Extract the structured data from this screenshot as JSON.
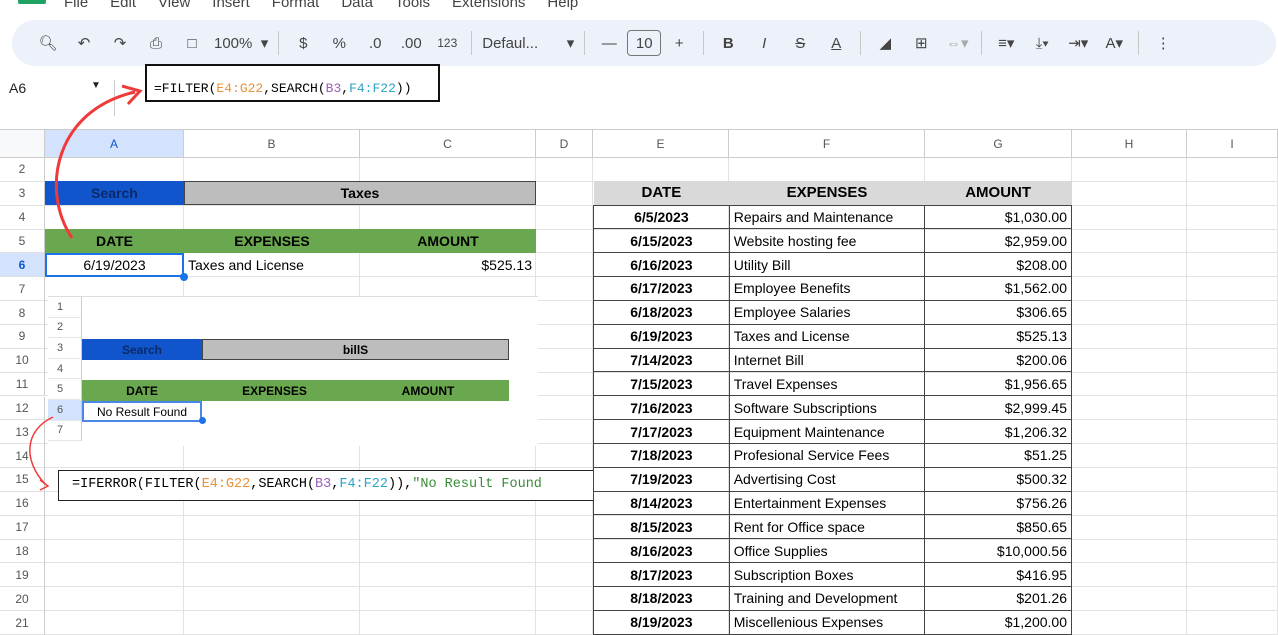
{
  "menu": [
    "File",
    "Edit",
    "View",
    "Insert",
    "Format",
    "Data",
    "Tools",
    "Extensions",
    "Help"
  ],
  "toolbar": {
    "zoom": "100%",
    "currency": "$",
    "percent": "%",
    "dec_less": ".0",
    "dec_more": ".00",
    "number_format": "123",
    "font": "Defaul...",
    "font_size": "10"
  },
  "name_box": "A6",
  "formula_bar": {
    "prefix": "=FILTER(",
    "r1": "E4:G22",
    "mid": ",SEARCH(",
    "r2": "B3",
    "comma": ",",
    "r3": "F4:F22",
    "suffix": "))"
  },
  "columns": [
    "A",
    "B",
    "C",
    "D",
    "E",
    "F",
    "G",
    "H",
    "I"
  ],
  "rows": [
    "2",
    "3",
    "4",
    "5",
    "6",
    "7",
    "8",
    "9",
    "10",
    "11",
    "12",
    "13",
    "14",
    "15",
    "16",
    "17",
    "18",
    "19",
    "20",
    "21"
  ],
  "search_block": {
    "label": "Search",
    "term": "Taxes",
    "headers": [
      "DATE",
      "EXPENSES",
      "AMOUNT"
    ],
    "result": {
      "date": "6/19/2023",
      "expense": "Taxes and License",
      "amount": "$525.13"
    }
  },
  "inset": {
    "rows": [
      "1",
      "2",
      "3",
      "4",
      "5",
      "6",
      "7"
    ],
    "label": "Search",
    "term": "billS",
    "headers": [
      "DATE",
      "EXPENSES",
      "AMOUNT"
    ],
    "result": "No Result Found",
    "formula": {
      "prefix": "=IFERROR(FILTER(",
      "r1": "E4:G22",
      "mid": ",SEARCH(",
      "r2": "B3",
      "comma": ",",
      "r3": "F4:F22",
      "close": ")),",
      "str": "\"No Result Found"
    }
  },
  "table": {
    "headers": [
      "DATE",
      "EXPENSES",
      "AMOUNT"
    ],
    "rows": [
      [
        "6/5/2023",
        "Repairs and Maintenance",
        "$1,030.00"
      ],
      [
        "6/15/2023",
        "Website hosting fee",
        "$2,959.00"
      ],
      [
        "6/16/2023",
        "Utility Bill",
        "$208.00"
      ],
      [
        "6/17/2023",
        "Employee Benefits",
        "$1,562.00"
      ],
      [
        "6/18/2023",
        "Employee Salaries",
        "$306.65"
      ],
      [
        "6/19/2023",
        "Taxes and License",
        "$525.13"
      ],
      [
        "7/14/2023",
        "Internet Bill",
        "$200.06"
      ],
      [
        "7/15/2023",
        "Travel Expenses",
        "$1,956.65"
      ],
      [
        "7/16/2023",
        "Software Subscriptions",
        "$2,999.45"
      ],
      [
        "7/17/2023",
        "Equipment Maintenance",
        "$1,206.32"
      ],
      [
        "7/18/2023",
        "Profesional Service Fees",
        "$51.25"
      ],
      [
        "7/19/2023",
        "Advertising Cost",
        "$500.32"
      ],
      [
        "8/14/2023",
        "Entertainment Expenses",
        "$756.26"
      ],
      [
        "8/15/2023",
        "Rent for Office space",
        "$850.65"
      ],
      [
        "8/16/2023",
        "Office Supplies",
        "$10,000.56"
      ],
      [
        "8/17/2023",
        "Subscription Boxes",
        "$416.95"
      ],
      [
        "8/18/2023",
        "Training and Development",
        "$201.26"
      ],
      [
        "8/19/2023",
        "Miscellenious Expenses",
        "$1,200.00"
      ]
    ]
  },
  "colors": {
    "search_blue": "#1155cc",
    "term_gray": "#bdbdbd",
    "header_green": "#6aa84f",
    "table_header": "#d9d9d9",
    "selection": "#1a73e8"
  }
}
